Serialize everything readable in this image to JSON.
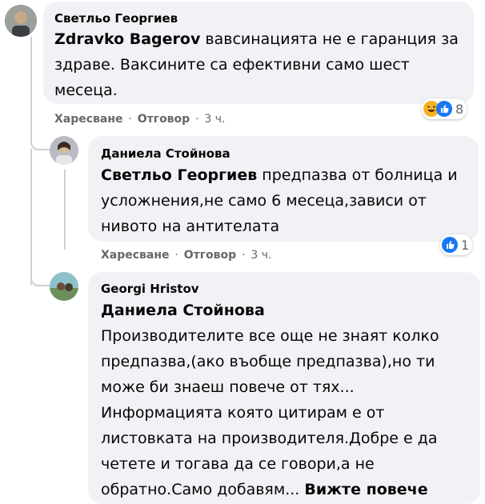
{
  "comments": [
    {
      "author": "Светльо Георгиев",
      "mention": "Zdravko Bagerov",
      "text": " вавсинацията не е гаранция за здраве. Ваксините са ефективни само шест месеца.",
      "like_label": "Харесване",
      "reply_label": "Отговор",
      "time": "3 ч.",
      "reaction_count": "8",
      "reaction_icons": [
        "haha-icon",
        "like-icon"
      ]
    },
    {
      "author": "Даниела Стойнова",
      "mention": "Светльо Георгиев",
      "text": " предпазва от болница и усложнения,не само 6 месеца,зависи от нивото на антителата",
      "like_label": "Харесване",
      "reply_label": "Отговор",
      "time": "3 ч.",
      "reaction_count": "1",
      "reaction_icons": [
        "like-icon"
      ]
    },
    {
      "author": "Georgi Hristov",
      "mention": "Даниела Стойнова",
      "text": "Производителите все още не знаят колко предпазва,(ако въобще предпазва),но ти може би знаеш повече от тях... Информацията която цитирам е от листовката на производителя.Добре е да четете и тогава да се говори,а не обратно.Само добавям...",
      "see_more": "Вижте повече"
    }
  ],
  "separator": "·",
  "colors": {
    "like": "#1877f2",
    "haha": "#f7b125",
    "bubble": "#f0f2f5",
    "meta": "#65676b"
  }
}
